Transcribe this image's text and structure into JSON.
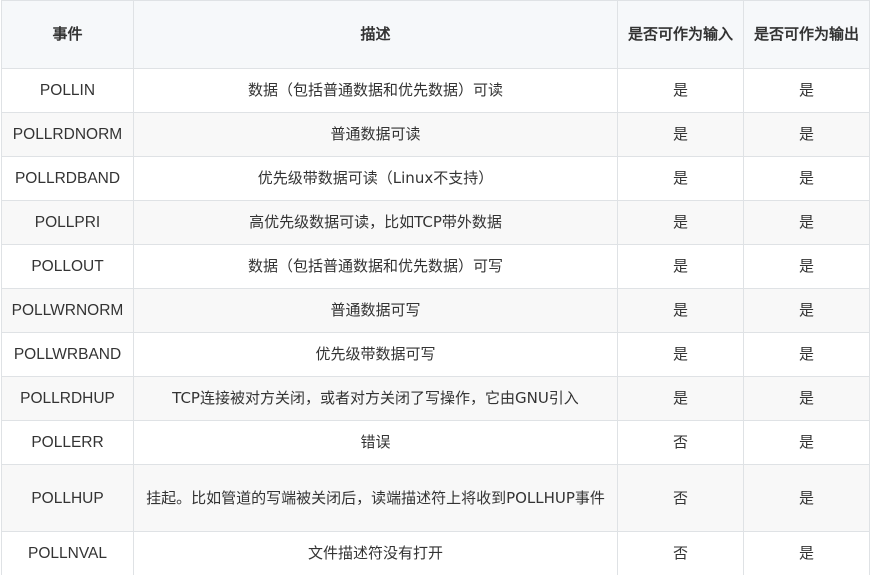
{
  "table": {
    "headers": [
      "事件",
      "描述",
      "是否可作为输入",
      "是否可作为输出"
    ],
    "rows": [
      {
        "event": "POLLIN",
        "desc": "数据（包括普通数据和优先数据）可读",
        "input": "是",
        "output": "是"
      },
      {
        "event": "POLLRDNORM",
        "desc": "普通数据可读",
        "input": "是",
        "output": "是"
      },
      {
        "event": "POLLRDBAND",
        "desc": "优先级带数据可读（Linux不支持）",
        "input": "是",
        "output": "是"
      },
      {
        "event": "POLLPRI",
        "desc": "高优先级数据可读，比如TCP带外数据",
        "input": "是",
        "output": "是"
      },
      {
        "event": "POLLOUT",
        "desc": "数据（包括普通数据和优先数据）可写",
        "input": "是",
        "output": "是"
      },
      {
        "event": "POLLWRNORM",
        "desc": "普通数据可写",
        "input": "是",
        "output": "是"
      },
      {
        "event": "POLLWRBAND",
        "desc": "优先级带数据可写",
        "input": "是",
        "output": "是"
      },
      {
        "event": "POLLRDHUP",
        "desc": "TCP连接被对方关闭，或者对方关闭了写操作，它由GNU引入",
        "input": "是",
        "output": "是"
      },
      {
        "event": "POLLERR",
        "desc": "错误",
        "input": "否",
        "output": "是"
      },
      {
        "event": "POLLHUP",
        "desc": "挂起。比如管道的写端被关闭后，读端描述符上将收到POLLHUP事件",
        "input": "否",
        "output": "是"
      },
      {
        "event": "POLLNVAL",
        "desc": "文件描述符没有打开",
        "input": "否",
        "output": "是"
      }
    ]
  }
}
